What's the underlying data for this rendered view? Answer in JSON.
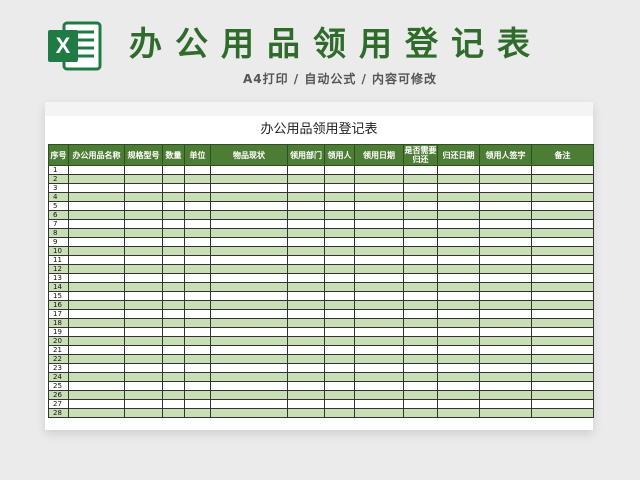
{
  "header": {
    "title": "办公用品领用登记表",
    "subtitle": "A4打印 / 自动公式 / 内容可修改",
    "logo_letter": "X"
  },
  "sheet": {
    "title": "办公用品领用登记表",
    "columns": [
      "序号",
      "办公用品名称",
      "规格型号",
      "数量",
      "单位",
      "物品现状",
      "领用部门",
      "领用人",
      "领用日期",
      "是否需要归还",
      "归还日期",
      "领用人签字",
      "备注"
    ],
    "rows": [
      "1",
      "2",
      "3",
      "4",
      "5",
      "6",
      "7",
      "8",
      "9",
      "10",
      "11",
      "12",
      "13",
      "14",
      "15",
      "16",
      "17",
      "18",
      "19",
      "20",
      "21",
      "22",
      "23",
      "24",
      "25",
      "26",
      "27",
      "28"
    ]
  },
  "colors": {
    "accent": "#2f6b2a",
    "header_bg": "#4d7c35",
    "stripe": "#c8dfb5",
    "logo": "#1f7a44"
  }
}
